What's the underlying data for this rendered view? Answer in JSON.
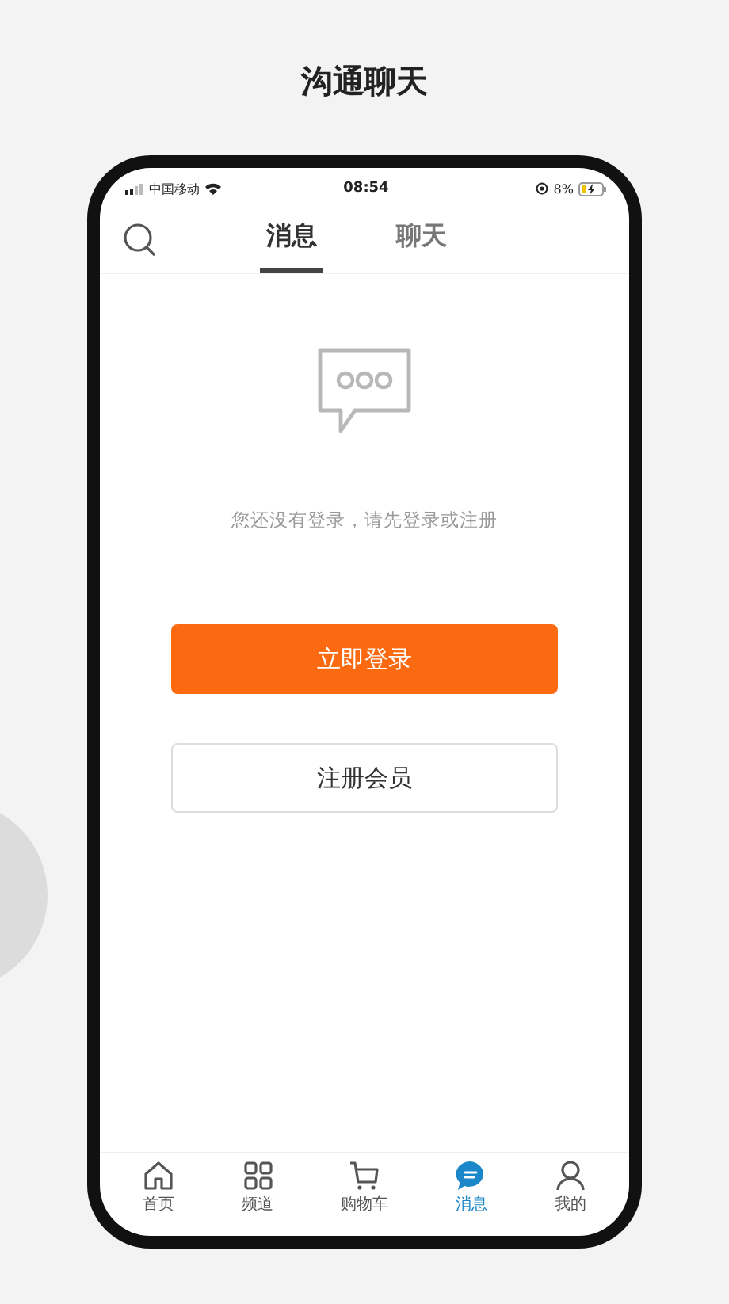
{
  "page_title": "沟通聊天",
  "status_bar": {
    "carrier": "中国移动",
    "time": "08:54",
    "battery": "8%"
  },
  "tabs": [
    {
      "label": "消息",
      "selected": true
    },
    {
      "label": "聊天",
      "selected": false
    }
  ],
  "empty_state": {
    "message": "您还没有登录，请先登录或注册"
  },
  "buttons": [
    {
      "kind": "primary",
      "label": "立即登录"
    },
    {
      "kind": "secondary",
      "label": "注册会员"
    }
  ],
  "bottom_nav": [
    {
      "kind": "home",
      "label": "首页",
      "selected": false
    },
    {
      "kind": "grid",
      "label": "频道",
      "selected": false
    },
    {
      "kind": "cart",
      "label": "购物车",
      "selected": false
    },
    {
      "kind": "chat",
      "label": "消息",
      "selected": true
    },
    {
      "kind": "user",
      "label": "我的",
      "selected": false
    }
  ]
}
